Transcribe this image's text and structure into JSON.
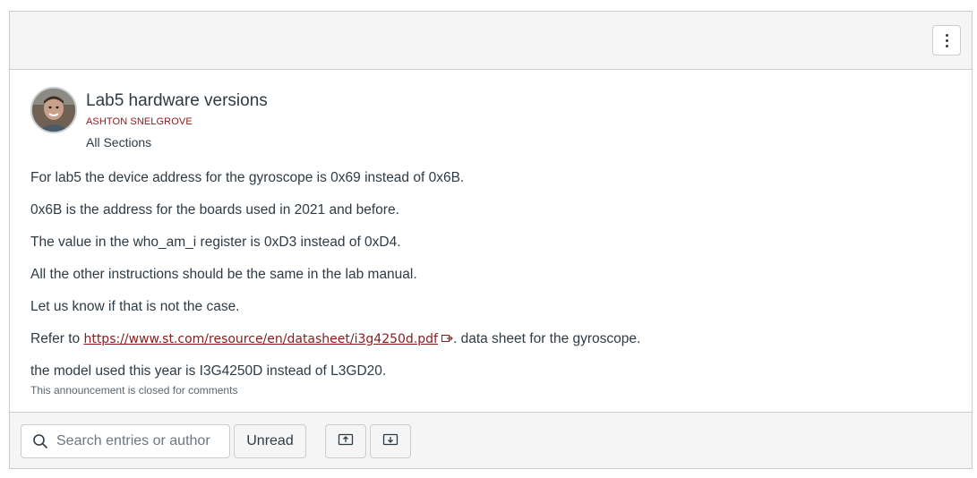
{
  "topbar": {
    "menu_icon": "kebab-vertical-icon"
  },
  "post": {
    "title": "Lab5 hardware versions",
    "author": "ASHTON SNELGROVE",
    "sections": "All Sections",
    "paragraphs": [
      "For lab5 the device address for the gyroscope is 0x69 instead of 0x6B.",
      "0x6B is the address for the boards used in 2021 and before.",
      "The value in the who_am_i register is 0xD3 instead of 0xD4.",
      "All the other instructions should be the same in the lab manual.",
      "Let us know if that is not the case."
    ],
    "refer_prefix": "Refer to ",
    "refer_link": "https://www.st.com/resource/en/datasheet/i3g4250d.pdf",
    "refer_suffix": ". data sheet for the gyroscope.",
    "model_line": "the model used this year is I3G4250D instead of L3GD20.",
    "closed_note": "This announcement is closed for comments"
  },
  "toolbar": {
    "search_placeholder": "Search entries or author",
    "unread_label": "Unread",
    "expand_icon": "upload-arrow-icon",
    "collapse_icon": "download-arrow-icon"
  },
  "colors": {
    "accent": "#8b1a1a",
    "border": "#c7cdd1",
    "bar_bg": "#f5f5f5",
    "text": "#2d3b45"
  }
}
